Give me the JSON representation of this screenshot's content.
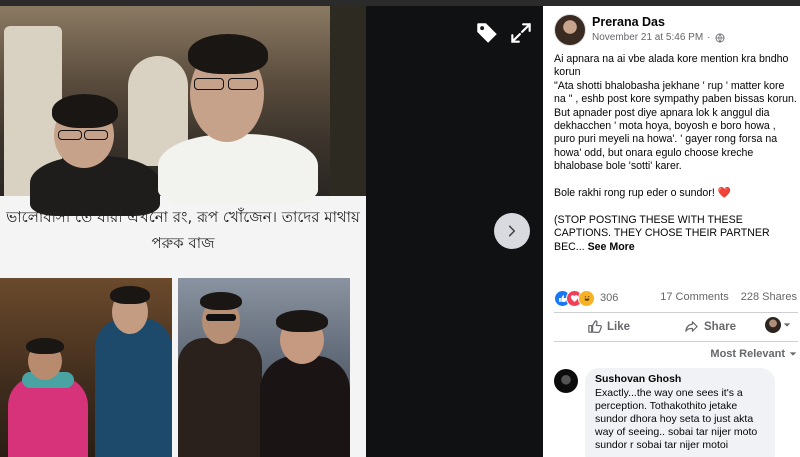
{
  "post": {
    "author": "Prerana Das",
    "timestamp": "November 21 at 5:46 PM",
    "separator": "·",
    "privacy_icon": "globe-icon",
    "text_lines": [
      "Ai apnara na ai vbe alada kore mention kra bndho korun",
      "\"Ata shotti bhalobasha jekhane ' rup ' matter kore na \" , eshb post kore sympathy paben bissas korun.",
      "But apnader post diye apnara lok k anggul dia dekhacchen ' mota hoya, boyosh e boro howa , puro puri meyeli na howa'. ' gayer rong forsa na howa' odd, but onara egulo choose kreche bhalobase bole 'sotti' karer."
    ],
    "closing_line": "Bole rakhi rong rup eder o sundor!",
    "closing_emoji": "❤️",
    "caps_line": "(STOP POSTING THESE WITH THESE CAPTIONS. THEY CHOSE THEIR PARTNER BEC...",
    "see_more": "See More"
  },
  "image": {
    "caption_line1": "ভালোবাসা তে যারা এখনো রং, রূপ খোঁজেন। তাদের মাথায়",
    "caption_line2": "পরুক বাজ"
  },
  "reactions": {
    "count": "306",
    "types": [
      "like",
      "love",
      "haha"
    ],
    "comments": "17 Comments",
    "shares": "228 Shares"
  },
  "actions": {
    "like": "Like",
    "share": "Share"
  },
  "comments": {
    "sort_label": "Most Relevant",
    "items": [
      {
        "author": "Sushovan Ghosh",
        "text": "Exactly...the way one sees it's a perception. Tothakothito jetake sundor dhora hoy seta to just akta way of seeing.. sobai tar nijer moto sundor r sobai tar nijer motoi"
      }
    ]
  },
  "colors": {
    "like": "#1877f2",
    "love": "#f33e58",
    "haha": "#f7b125"
  }
}
